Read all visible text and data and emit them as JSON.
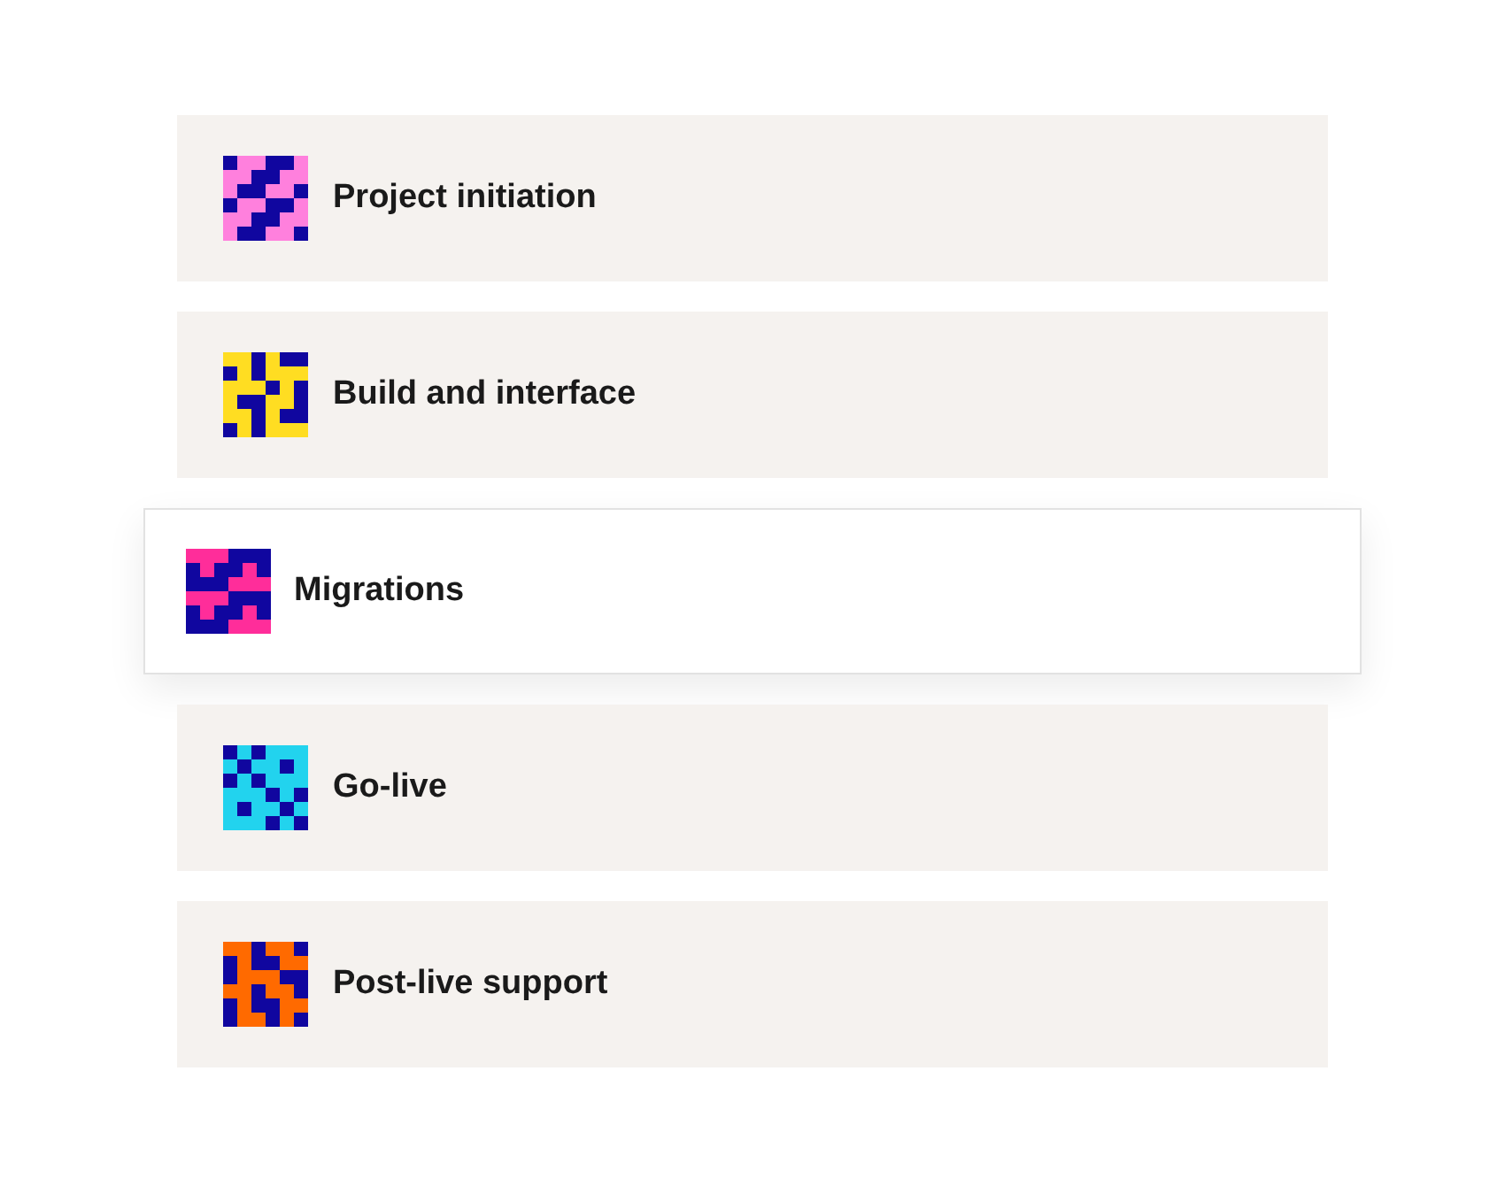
{
  "items": [
    {
      "label": "Project initiation",
      "color": "#ff80dd",
      "selected": false
    },
    {
      "label": "Build and interface",
      "color": "#ffdd22",
      "selected": false
    },
    {
      "label": "Migrations",
      "color": "#ff2d9a",
      "selected": true
    },
    {
      "label": "Go-live",
      "color": "#22d3ee",
      "selected": false
    },
    {
      "label": "Post-live support",
      "color": "#ff6a00",
      "selected": false
    }
  ]
}
